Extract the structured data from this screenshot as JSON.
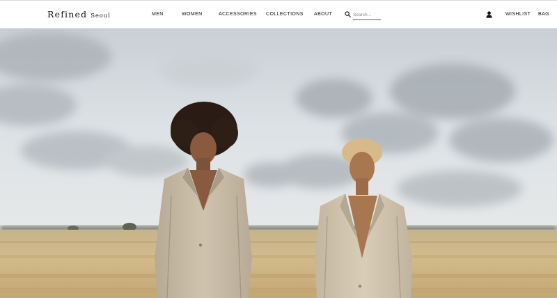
{
  "brand": {
    "name": "Refined",
    "sub": "Seoul"
  },
  "nav": {
    "men": "MEN",
    "women": "WOMEN",
    "accessories": "ACCESSORIES",
    "collections": "COLLECTIONS",
    "about": "ABOUT"
  },
  "search": {
    "placeholder": "Search...",
    "value": ""
  },
  "utility": {
    "wishlist": "WISHLIST",
    "bag": "BAG"
  },
  "icons": {
    "search": "search-icon",
    "account": "user-icon"
  },
  "colors": {
    "header_bg": "#ffffff",
    "text": "#111111"
  }
}
